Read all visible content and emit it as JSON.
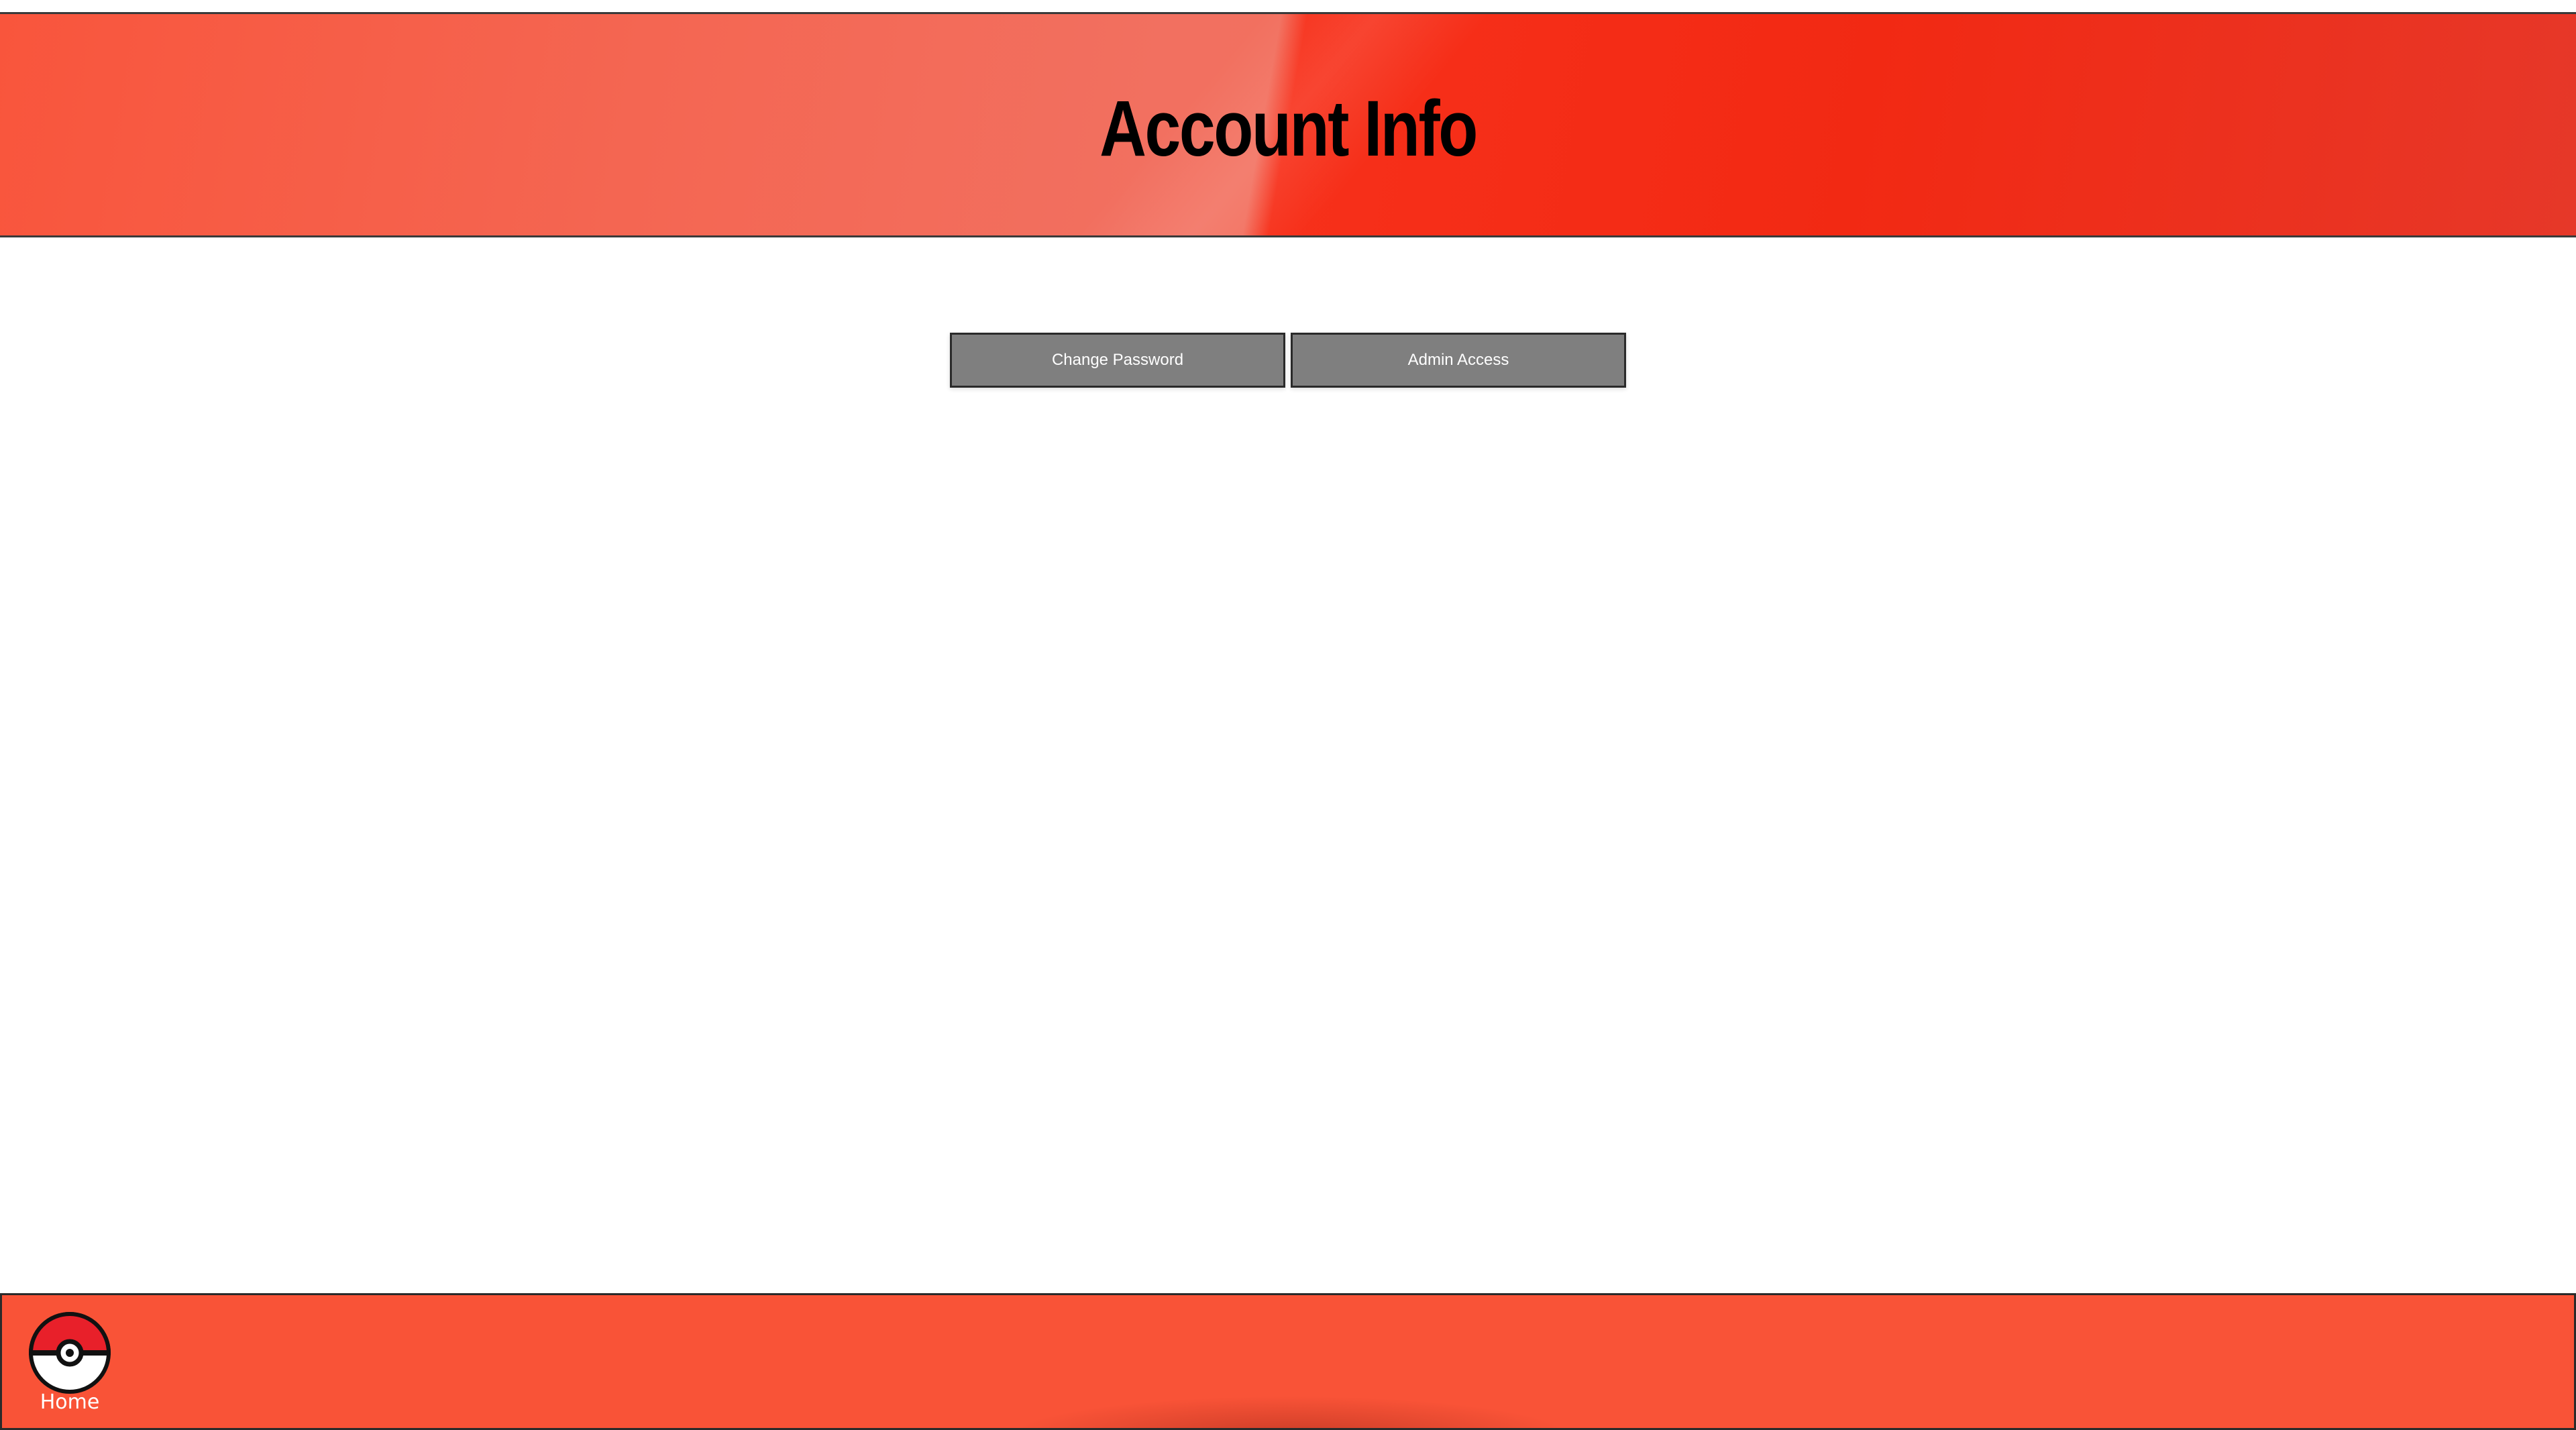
{
  "header": {
    "title": "Account Info"
  },
  "actions": {
    "change_password_label": "Change Password",
    "admin_access_label": "Admin Access"
  },
  "footer": {
    "home_label": "Home",
    "home_icon": "pokeball-icon"
  },
  "colors": {
    "header_red": "#f7301a",
    "footer_red": "#f95337",
    "button_gray": "#7f7f7f"
  }
}
